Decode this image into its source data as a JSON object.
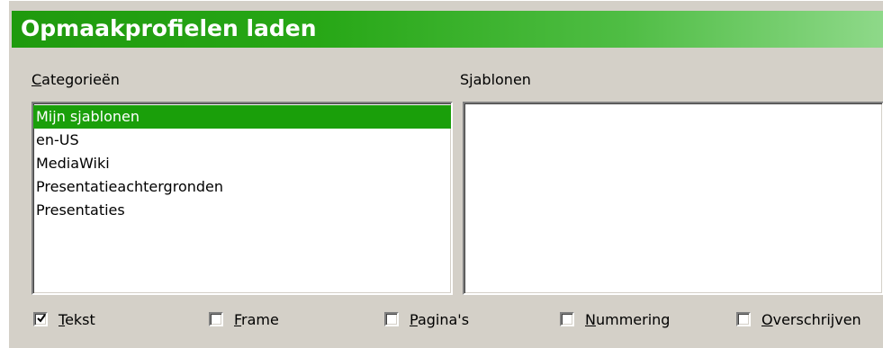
{
  "dialog": {
    "title": "Opmaakprofielen laden"
  },
  "categories": {
    "label_first": "C",
    "label_rest": "ategorieën",
    "items": [
      "Mijn sjablonen",
      "en-US",
      "MediaWiki",
      "Presentatieachtergronden",
      "Presentaties"
    ],
    "selected_index": 0
  },
  "templates": {
    "label_pre": "S",
    "label_u": "j",
    "label_post": "ablonen",
    "items": []
  },
  "options": [
    {
      "first": "T",
      "rest": "ekst",
      "checked": true
    },
    {
      "first": "F",
      "rest": "rame",
      "checked": false
    },
    {
      "first": "P",
      "rest": "agina's",
      "checked": false
    },
    {
      "first": "N",
      "rest": "ummering",
      "checked": false
    },
    {
      "first": "O",
      "rest": "verschrijven",
      "checked": false
    }
  ],
  "colors": {
    "selection": "#1a9f0a",
    "titlebar_start": "#1f9a0e",
    "titlebar_end": "#8fd98a",
    "dialog_bg": "#d4d0c8"
  }
}
